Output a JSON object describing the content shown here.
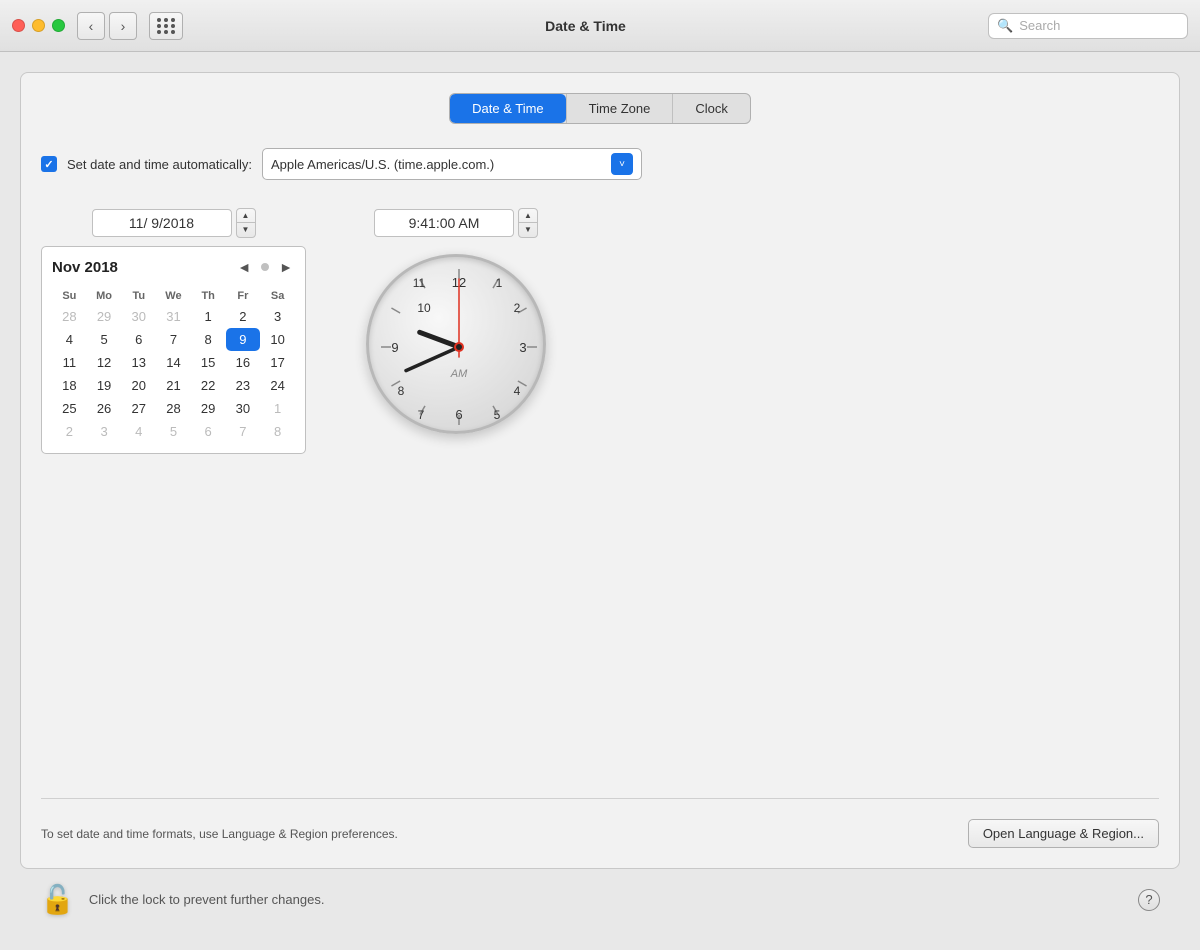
{
  "titlebar": {
    "title": "Date & Time",
    "search_placeholder": "Search"
  },
  "tabs": [
    {
      "id": "date-time",
      "label": "Date & Time",
      "active": true
    },
    {
      "id": "time-zone",
      "label": "Time Zone",
      "active": false
    },
    {
      "id": "clock",
      "label": "Clock",
      "active": false
    }
  ],
  "auto_time": {
    "label": "Set date and time automatically:",
    "checked": true,
    "server": "Apple Americas/U.S. (time.apple.com.)"
  },
  "date": {
    "display": "11/  9/2018"
  },
  "time": {
    "display": "9:41:00 AM"
  },
  "calendar": {
    "header": "Nov 2018",
    "days_of_week": [
      "Su",
      "Mo",
      "Tu",
      "We",
      "Th",
      "Fr",
      "Sa"
    ],
    "weeks": [
      [
        "28",
        "29",
        "30",
        "31",
        "1",
        "2",
        "3"
      ],
      [
        "4",
        "5",
        "6",
        "7",
        "8",
        "9",
        "10"
      ],
      [
        "11",
        "12",
        "13",
        "14",
        "15",
        "16",
        "17"
      ],
      [
        "18",
        "19",
        "20",
        "21",
        "22",
        "23",
        "24"
      ],
      [
        "25",
        "26",
        "27",
        "28",
        "29",
        "30",
        "1"
      ],
      [
        "2",
        "3",
        "4",
        "5",
        "6",
        "7",
        "8"
      ]
    ],
    "week_types": [
      [
        "other",
        "other",
        "other",
        "other",
        "current",
        "current",
        "current"
      ],
      [
        "current",
        "current",
        "current",
        "current",
        "current",
        "selected",
        "current"
      ],
      [
        "current",
        "current",
        "current",
        "current",
        "current",
        "current",
        "current"
      ],
      [
        "current",
        "current",
        "current",
        "current",
        "current",
        "current",
        "current"
      ],
      [
        "current",
        "current",
        "current",
        "current",
        "current",
        "current",
        "other"
      ],
      [
        "other",
        "other",
        "other",
        "other",
        "other",
        "other",
        "other"
      ]
    ]
  },
  "clock": {
    "am_label": "AM",
    "hour_hand_angle": 285,
    "minute_hand_angle": 246,
    "second_hand_angle": 0
  },
  "bottom": {
    "text": "To set date and time formats, use Language & Region preferences.",
    "button": "Open Language & Region..."
  },
  "footer": {
    "lock_text": "Click the lock to prevent further changes.",
    "help_label": "?"
  }
}
